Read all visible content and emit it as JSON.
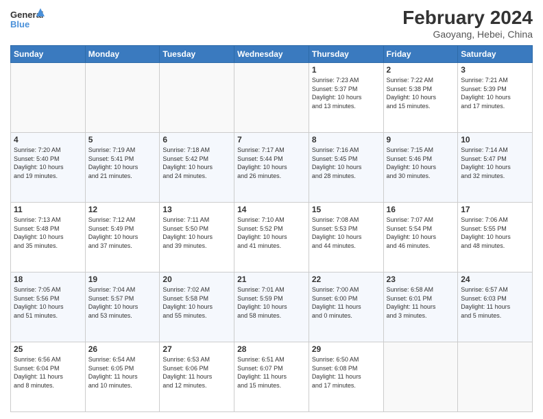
{
  "logo": {
    "line1": "General",
    "line2": "Blue"
  },
  "title": "February 2024",
  "subtitle": "Gaoyang, Hebei, China",
  "weekdays": [
    "Sunday",
    "Monday",
    "Tuesday",
    "Wednesday",
    "Thursday",
    "Friday",
    "Saturday"
  ],
  "weeks": [
    [
      {
        "day": "",
        "info": ""
      },
      {
        "day": "",
        "info": ""
      },
      {
        "day": "",
        "info": ""
      },
      {
        "day": "",
        "info": ""
      },
      {
        "day": "1",
        "info": "Sunrise: 7:23 AM\nSunset: 5:37 PM\nDaylight: 10 hours\nand 13 minutes."
      },
      {
        "day": "2",
        "info": "Sunrise: 7:22 AM\nSunset: 5:38 PM\nDaylight: 10 hours\nand 15 minutes."
      },
      {
        "day": "3",
        "info": "Sunrise: 7:21 AM\nSunset: 5:39 PM\nDaylight: 10 hours\nand 17 minutes."
      }
    ],
    [
      {
        "day": "4",
        "info": "Sunrise: 7:20 AM\nSunset: 5:40 PM\nDaylight: 10 hours\nand 19 minutes."
      },
      {
        "day": "5",
        "info": "Sunrise: 7:19 AM\nSunset: 5:41 PM\nDaylight: 10 hours\nand 21 minutes."
      },
      {
        "day": "6",
        "info": "Sunrise: 7:18 AM\nSunset: 5:42 PM\nDaylight: 10 hours\nand 24 minutes."
      },
      {
        "day": "7",
        "info": "Sunrise: 7:17 AM\nSunset: 5:44 PM\nDaylight: 10 hours\nand 26 minutes."
      },
      {
        "day": "8",
        "info": "Sunrise: 7:16 AM\nSunset: 5:45 PM\nDaylight: 10 hours\nand 28 minutes."
      },
      {
        "day": "9",
        "info": "Sunrise: 7:15 AM\nSunset: 5:46 PM\nDaylight: 10 hours\nand 30 minutes."
      },
      {
        "day": "10",
        "info": "Sunrise: 7:14 AM\nSunset: 5:47 PM\nDaylight: 10 hours\nand 32 minutes."
      }
    ],
    [
      {
        "day": "11",
        "info": "Sunrise: 7:13 AM\nSunset: 5:48 PM\nDaylight: 10 hours\nand 35 minutes."
      },
      {
        "day": "12",
        "info": "Sunrise: 7:12 AM\nSunset: 5:49 PM\nDaylight: 10 hours\nand 37 minutes."
      },
      {
        "day": "13",
        "info": "Sunrise: 7:11 AM\nSunset: 5:50 PM\nDaylight: 10 hours\nand 39 minutes."
      },
      {
        "day": "14",
        "info": "Sunrise: 7:10 AM\nSunset: 5:52 PM\nDaylight: 10 hours\nand 41 minutes."
      },
      {
        "day": "15",
        "info": "Sunrise: 7:08 AM\nSunset: 5:53 PM\nDaylight: 10 hours\nand 44 minutes."
      },
      {
        "day": "16",
        "info": "Sunrise: 7:07 AM\nSunset: 5:54 PM\nDaylight: 10 hours\nand 46 minutes."
      },
      {
        "day": "17",
        "info": "Sunrise: 7:06 AM\nSunset: 5:55 PM\nDaylight: 10 hours\nand 48 minutes."
      }
    ],
    [
      {
        "day": "18",
        "info": "Sunrise: 7:05 AM\nSunset: 5:56 PM\nDaylight: 10 hours\nand 51 minutes."
      },
      {
        "day": "19",
        "info": "Sunrise: 7:04 AM\nSunset: 5:57 PM\nDaylight: 10 hours\nand 53 minutes."
      },
      {
        "day": "20",
        "info": "Sunrise: 7:02 AM\nSunset: 5:58 PM\nDaylight: 10 hours\nand 55 minutes."
      },
      {
        "day": "21",
        "info": "Sunrise: 7:01 AM\nSunset: 5:59 PM\nDaylight: 10 hours\nand 58 minutes."
      },
      {
        "day": "22",
        "info": "Sunrise: 7:00 AM\nSunset: 6:00 PM\nDaylight: 11 hours\nand 0 minutes."
      },
      {
        "day": "23",
        "info": "Sunrise: 6:58 AM\nSunset: 6:01 PM\nDaylight: 11 hours\nand 3 minutes."
      },
      {
        "day": "24",
        "info": "Sunrise: 6:57 AM\nSunset: 6:03 PM\nDaylight: 11 hours\nand 5 minutes."
      }
    ],
    [
      {
        "day": "25",
        "info": "Sunrise: 6:56 AM\nSunset: 6:04 PM\nDaylight: 11 hours\nand 8 minutes."
      },
      {
        "day": "26",
        "info": "Sunrise: 6:54 AM\nSunset: 6:05 PM\nDaylight: 11 hours\nand 10 minutes."
      },
      {
        "day": "27",
        "info": "Sunrise: 6:53 AM\nSunset: 6:06 PM\nDaylight: 11 hours\nand 12 minutes."
      },
      {
        "day": "28",
        "info": "Sunrise: 6:51 AM\nSunset: 6:07 PM\nDaylight: 11 hours\nand 15 minutes."
      },
      {
        "day": "29",
        "info": "Sunrise: 6:50 AM\nSunset: 6:08 PM\nDaylight: 11 hours\nand 17 minutes."
      },
      {
        "day": "",
        "info": ""
      },
      {
        "day": "",
        "info": ""
      }
    ]
  ]
}
